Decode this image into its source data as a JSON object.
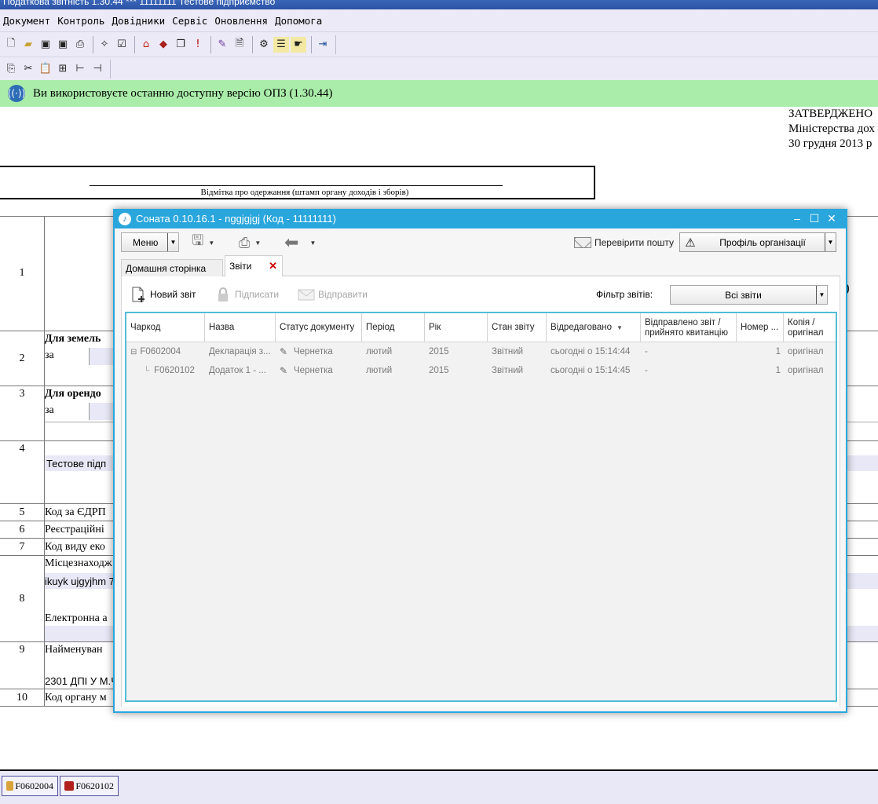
{
  "app": {
    "title": "Податкова звітність 1.30.44 *** 11111111 Тестове підприємство",
    "menu": [
      "Документ",
      "Контроль",
      "Довідники",
      "Сервіс",
      "Оновлення",
      "Допомога"
    ],
    "info_message": "Ви використовуєте останню доступну версію ОПЗ (1.30.44)"
  },
  "document": {
    "approved_lines": [
      "ЗАТВЕРДЖЕНО",
      "Міністерства дох",
      "30 грудня 2013 р"
    ],
    "stamp_label": "Відмітка про одержання (штамп органу доходів і зборів)",
    "right_paren": ")",
    "rows": {
      "r1": {
        "num": "1"
      },
      "r2": {
        "num": "2",
        "text": "Для земель",
        "sub": "за"
      },
      "r3": {
        "num": "3",
        "text": "Для орендо",
        "sub": "за"
      },
      "r4": {
        "num": "4",
        "value": "Тестове підп"
      },
      "r5": {
        "num": "5",
        "text": "Код за ЄДРП"
      },
      "r6": {
        "num": "6",
        "text": "Реєстраційні"
      },
      "r7": {
        "num": "7",
        "text": "Код виду еко"
      },
      "r8": {
        "num": "8",
        "text": "Місцезнаходж",
        "value": "ikuyk ujgyjhm 7",
        "text2": "Електронна а"
      },
      "r9": {
        "num": "9",
        "text": "Найменуван",
        "value": "2301 ДПІ У М.Ч"
      },
      "r10": {
        "num": "10",
        "text": "Код органу м"
      }
    }
  },
  "bottom_tabs": [
    {
      "label": "F0602004",
      "color": "#d9a23a"
    },
    {
      "label": "F0620102",
      "color": "#b2201e"
    }
  ],
  "dialog": {
    "title": "Соната 0.10.16.1 - nggjgjgj (Код - 11111111)",
    "menu_label": "Меню",
    "check_mail": "Перевірити пошту",
    "profile": "Профіль організації",
    "tabs": {
      "home": "Домашня сторінка",
      "reports": "Звіти"
    },
    "toolbar": {
      "new_report": "Новий звіт",
      "sign": "Підписати",
      "send": "Відправити",
      "filter_label": "Фільтр звітів:",
      "filter_value": "Всі звіти"
    },
    "columns": [
      "Чаркод",
      "Назва",
      "Статус документу",
      "Період",
      "Рік",
      "Стан звіту",
      "Відредаговано",
      "Відправлено звіт / прийнято квитанцію",
      "Номер ...",
      "Копія / оригінал"
    ],
    "rows": [
      {
        "code": "F0602004",
        "name": "Декларація з...",
        "status": "Чернетка",
        "period": "лютий",
        "year": "2015",
        "state": "Звітний",
        "edited": "сьогодні о 15:14:44",
        "sent": "-",
        "number": "1",
        "copy": "оригінал"
      },
      {
        "code": "F0620102",
        "name": "Додаток 1 - ...",
        "status": "Чернетка",
        "period": "лютий",
        "year": "2015",
        "state": "Звітний",
        "edited": "сьогодні о 15:14:45",
        "sent": "-",
        "number": "1",
        "copy": "оригінал"
      }
    ]
  }
}
